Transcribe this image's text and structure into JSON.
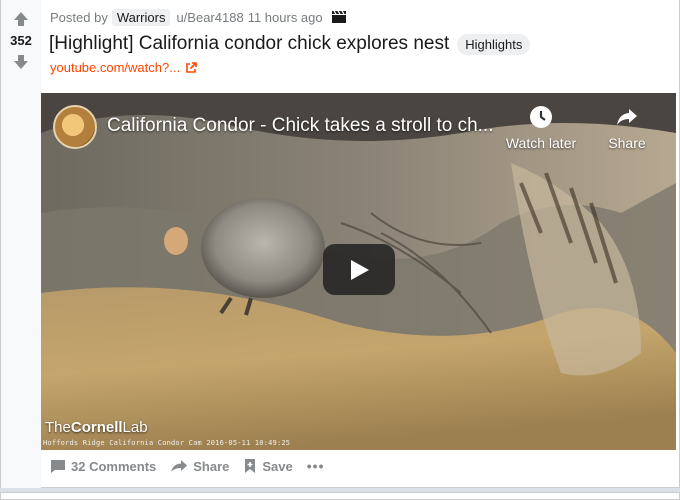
{
  "post": {
    "score": "352",
    "posted_by_label": "Posted by",
    "subreddit_flair": "Warriors",
    "user": "u/Bear4188",
    "time": "11 hours ago",
    "title": "[Highlight] California condor chick explores nest",
    "flair": "Highlights",
    "link_text": "youtube.com/watch?...",
    "comments_label": "32 Comments",
    "share_label": "Share",
    "save_label": "Save",
    "more_label": "•••"
  },
  "video": {
    "title": "California Condor - Chick takes a stroll to ch...",
    "watch_later_label": "Watch later",
    "share_label": "Share",
    "brand_prefix": "The",
    "brand_bold": "Cornell",
    "brand_suffix": "Lab",
    "camera_stamp": "Hoffords Ridge California Condor Cam 2016-05-11 10:49:25"
  },
  "colors": {
    "link": "#ff4500",
    "meta_gray": "#787c7e",
    "action_gray": "#878a8c",
    "flair_bg": "#edeff1"
  },
  "icons": [
    "upvote-icon",
    "downvote-icon",
    "clapperboard-icon",
    "external-link-icon",
    "clock-icon",
    "share-arrow-icon",
    "play-icon",
    "comment-icon",
    "share-icon",
    "save-icon"
  ]
}
